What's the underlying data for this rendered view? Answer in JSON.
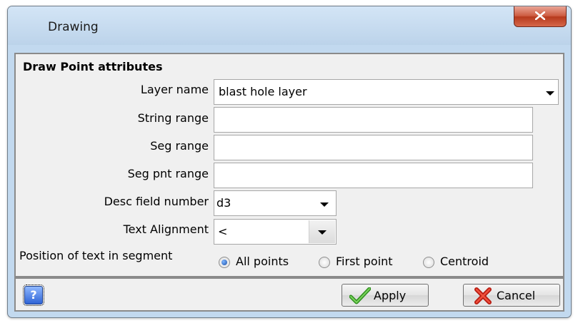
{
  "window": {
    "title": "Drawing"
  },
  "group": {
    "title": "Draw Point attributes"
  },
  "fields": {
    "layer_name": {
      "label": "Layer name",
      "value": "blast hole layer"
    },
    "string_range": {
      "label": "String range",
      "value": ""
    },
    "seg_range": {
      "label": "Seg range",
      "value": ""
    },
    "seg_pnt_range": {
      "label": "Seg pnt range",
      "value": ""
    },
    "desc_field_number": {
      "label": "Desc field number",
      "value": "d3"
    },
    "text_alignment": {
      "label": "Text Alignment",
      "value": "<"
    }
  },
  "position": {
    "label": "Position of text in segment",
    "options": [
      "All points",
      "First point",
      "Centroid"
    ],
    "selected": "All points"
  },
  "buttons": {
    "help": "?",
    "apply": "Apply",
    "cancel": "Cancel"
  },
  "icons": {
    "apply": "checkmark-icon",
    "cancel": "red-x-icon",
    "help": "help-icon",
    "close": "close-icon"
  },
  "colors": {
    "titlebar": "#c2d9ef",
    "close": "#c9472a",
    "apply_check": "#3aa328",
    "cancel_x": "#d92b1e"
  }
}
